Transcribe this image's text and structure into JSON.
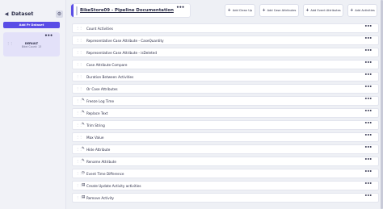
{
  "sidebar": {
    "title": "Dataset",
    "back_icon": "arrow-left-icon",
    "settings_icon": "gear-icon",
    "add_button": "Add Pr Dataset",
    "dataset": {
      "name": "DEFAULT",
      "subtitle": "Bikei Count: 13",
      "menu_glyph": "•••"
    }
  },
  "header": {
    "pipeline_title": "BikeStore09 - Pipeline Documentation",
    "menu_glyph": "•••",
    "buttons": [
      {
        "label": "Add Clean Up",
        "icon": "plus-icon"
      },
      {
        "label": "Add Case Attributes",
        "icon": "plus-icon"
      },
      {
        "label": "Add Event Attributes",
        "icon": "plus-icon"
      },
      {
        "label": "Add Activities",
        "icon": "plus-icon"
      }
    ]
  },
  "steps": [
    {
      "label": "Count Activities",
      "icon": ""
    },
    {
      "label": "Representative Case Attribute - CaseQuantity",
      "icon": ""
    },
    {
      "label": "Representative Case Attribute - isDeleted",
      "icon": ""
    },
    {
      "label": "Case Attribute Compare",
      "icon": ""
    },
    {
      "label": "Duration Between Activities",
      "icon": ""
    },
    {
      "label": "Or Case Attributes",
      "icon": ""
    },
    {
      "label": "Freeze Log Time",
      "icon": "brush-icon"
    },
    {
      "label": "Replace Text",
      "icon": "brush-icon"
    },
    {
      "label": "Trim String",
      "icon": "brush-icon"
    },
    {
      "label": "Max Value",
      "icon": ""
    },
    {
      "label": "Hide Attribute",
      "icon": "brush-icon"
    },
    {
      "label": "Rename Attribute",
      "icon": "brush-icon"
    },
    {
      "label": "Event Time Difference",
      "icon": "clock-icon"
    },
    {
      "label": "Create Update Activity activities",
      "icon": "chart-icon"
    },
    {
      "label": "Remove Activity",
      "icon": "chart-icon"
    }
  ],
  "row_menu_glyph": "•••",
  "colors": {
    "accent": "#5a4de6",
    "background": "#eef0f5"
  }
}
